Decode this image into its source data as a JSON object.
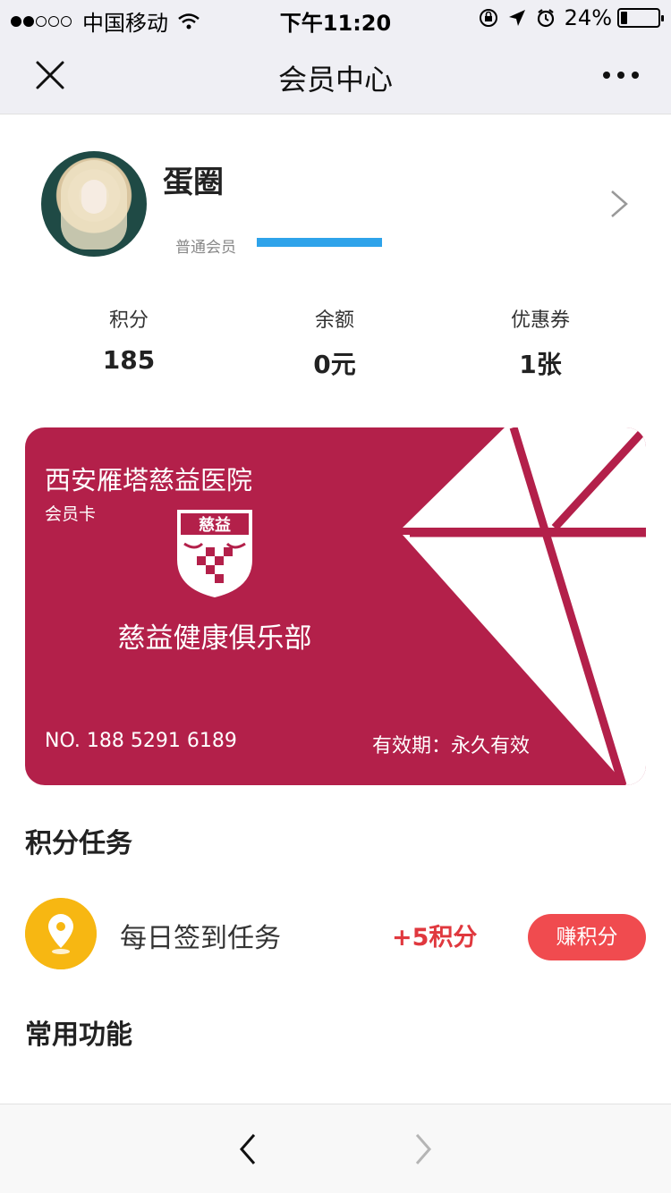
{
  "status_bar": {
    "carrier": "中国移动",
    "time": "下午11:20",
    "battery": "24%",
    "battery_level": 0.24,
    "signal_bars": 2,
    "icons": [
      "wifi-icon",
      "orientation-lock-icon",
      "location-icon",
      "alarm-icon",
      "battery-icon"
    ]
  },
  "nav": {
    "title": "会员中心",
    "left_icon": "close-icon",
    "right_icon": "more-icon"
  },
  "profile": {
    "name": "蛋圈",
    "member_level": "普通会员",
    "level_progress": 1.0,
    "level_color": "#2ea3ea",
    "arrow_icon": "chevron-right-icon"
  },
  "stats": [
    {
      "label": "积分",
      "value": "185"
    },
    {
      "label": "余额",
      "value": "0元"
    },
    {
      "label": "优惠券",
      "value": "1张"
    }
  ],
  "card": {
    "hospital": "西安雁塔慈益医院",
    "type": "会员卡",
    "logo_text": "慈益",
    "club": "慈益健康俱乐部",
    "number": "NO. 188 5291 6189",
    "validity": "有效期：永久有效",
    "color": "#b3204a"
  },
  "sections": {
    "points_tasks": "积分任务",
    "common_functions": "常用功能"
  },
  "task": {
    "name": "每日签到任务",
    "points": "+5积分",
    "button": "赚积分",
    "icon": "location-pin-icon",
    "icon_color": "#f7b712",
    "button_color": "#f04b4f"
  },
  "bottom_bar": {
    "back_icon": "chevron-left-icon",
    "forward_icon": "chevron-right-icon"
  }
}
